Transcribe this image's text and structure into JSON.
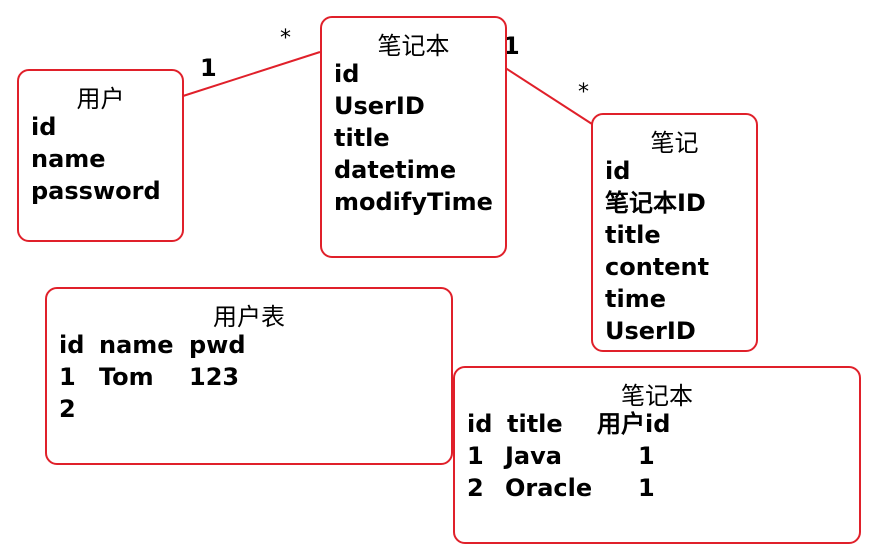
{
  "entities": {
    "user": {
      "title": "用户",
      "fields": [
        "id",
        "name",
        "password"
      ]
    },
    "notebook": {
      "title": "笔记本",
      "fields": [
        "id",
        "UserID",
        "title",
        "datetime",
        "modifyTime"
      ]
    },
    "note": {
      "title": "笔记",
      "fields": [
        "id",
        "笔记本ID",
        "title",
        "content",
        "time",
        "UserID"
      ]
    }
  },
  "relations": {
    "user_notebook": {
      "left": "1",
      "right": "*"
    },
    "notebook_note": {
      "left": "1",
      "right": "*"
    }
  },
  "tables": {
    "user_table": {
      "title": "用户表",
      "headers": [
        "id",
        "name",
        "pwd"
      ],
      "rows": [
        [
          "1",
          "Tom",
          "123"
        ],
        [
          "2",
          "",
          ""
        ]
      ]
    },
    "notebook_table": {
      "title": "笔记本",
      "headers": [
        "id",
        "title",
        "用户id"
      ],
      "rows": [
        [
          "1",
          "Java",
          "1"
        ],
        [
          "2",
          "Oracle",
          "1"
        ]
      ]
    }
  },
  "colors": {
    "border": "#e0202a",
    "line": "#e0202a"
  }
}
